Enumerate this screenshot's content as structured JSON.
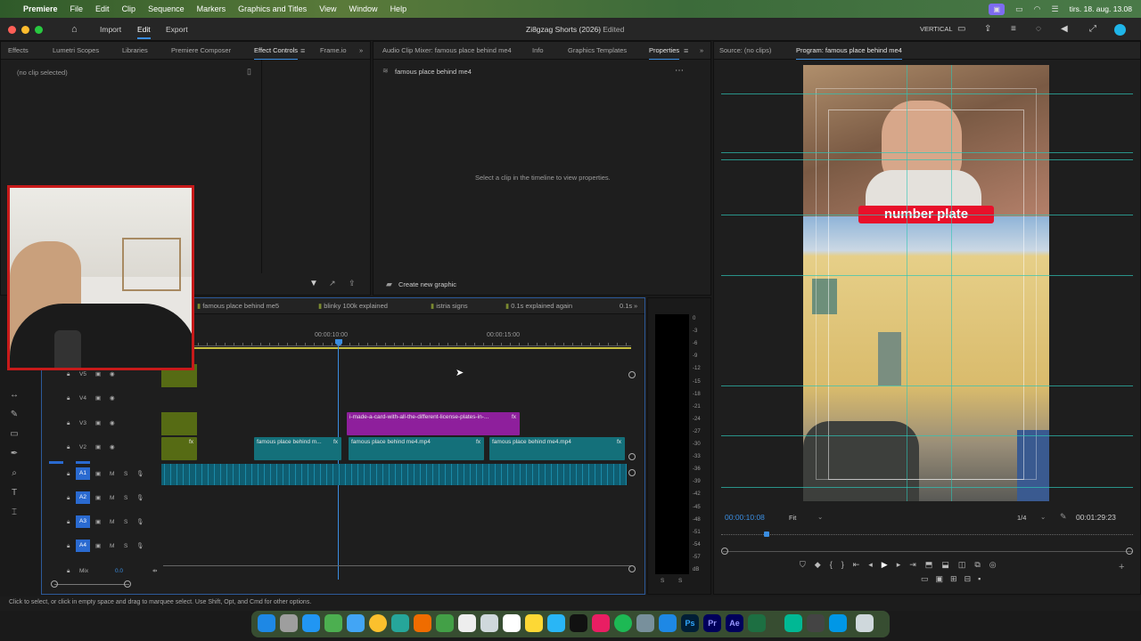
{
  "menubar": {
    "app": "Premiere",
    "items": [
      "File",
      "Edit",
      "Clip",
      "Sequence",
      "Markers",
      "Graphics and Titles",
      "View",
      "Window",
      "Help"
    ],
    "datetime": "tirs. 18. aug. 13.08"
  },
  "titlebar": {
    "import": "Import",
    "edit": "Edit",
    "export": "Export",
    "title": "Zi8gzag Shorts (2026)",
    "edited": "- Edited",
    "layout": "VERTICAL"
  },
  "left_panel": {
    "tabs": [
      "Effects",
      "Lumetri Scopes",
      "Libraries",
      "Premiere Composer",
      "Effect Controls",
      "Frame.io"
    ],
    "no_clip": "(no clip selected)"
  },
  "mid_panel": {
    "tabs": [
      "Audio Clip Mixer: famous place behind me4",
      "Info",
      "Graphics Templates",
      "Properties"
    ],
    "heading": "famous place behind me4",
    "hint": "Select a clip in the timeline to view properties.",
    "create_graphic": "Create new graphic"
  },
  "right_panel": {
    "tabs": [
      "Source: (no clips)",
      "Program: famous place behind me4"
    ],
    "caption": "number plate",
    "timecode": "00:00:10:08",
    "fit": "Fit",
    "quality": "1/4",
    "duration": "00:01:29:23"
  },
  "timeline": {
    "sequence_tabs": [
      "famous place behind me5",
      "blinky 100k explained",
      "istria signs",
      "0.1s explained again",
      "0.1s"
    ],
    "ruler": [
      "00:00:10:00",
      "00:00:15:00"
    ],
    "video_tracks": [
      "V5",
      "V4",
      "V3",
      "V2"
    ],
    "audio_tracks": [
      "A1",
      "A2",
      "A3",
      "A4"
    ],
    "mix_label": "Mix",
    "mix_value": "0.0",
    "clips": {
      "v3": "i-made-a-card-with-all-the-different-license-plates-in-...",
      "v2a": "famous place behind m...",
      "v2b": "famous place behind me4.mp4",
      "v2c": "famous place behind me4.mp4",
      "fx": "fx"
    }
  },
  "meter": {
    "scale": [
      "0",
      "-3",
      "-6",
      "-9",
      "-12",
      "-15",
      "-18",
      "-21",
      "-24",
      "-27",
      "-30",
      "-33",
      "-36",
      "-39",
      "-42",
      "-45",
      "-48",
      "-51",
      "-54",
      "-57",
      "dB"
    ],
    "bottom": [
      "S",
      "S"
    ]
  },
  "status": "Click to select, or click in empty space and drag to marquee select. Use Shift, Opt, and Cmd for other options.",
  "colors": {
    "accent": "#3a8de0",
    "clip_v2": "#14707a",
    "clip_v3": "#8e1f9c",
    "audio": "#0f5e72",
    "caption_bg": "#e8102a"
  }
}
